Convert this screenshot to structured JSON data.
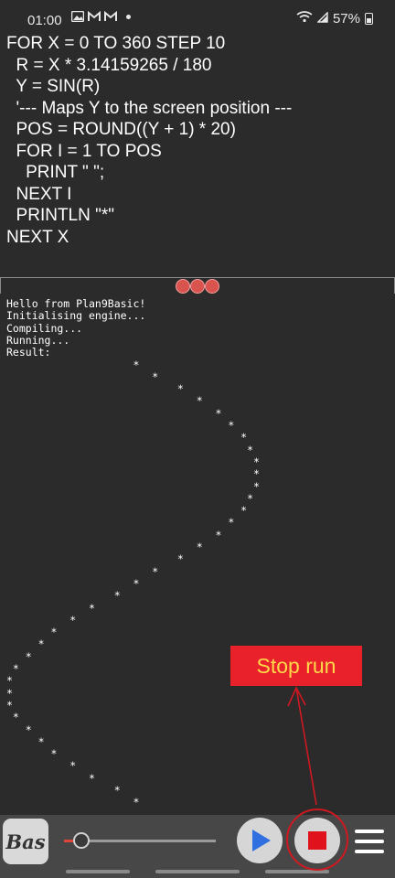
{
  "status_bar": {
    "time": "01:00",
    "battery": "57%",
    "left_icons": [
      "gallery-icon",
      "gmail-icon",
      "gmail-icon",
      "notification-dot"
    ],
    "right_icons": [
      "wifi-icon",
      "signal-icon",
      "battery-icon"
    ]
  },
  "editor": {
    "lines": [
      "FOR X = 0 TO 360 STEP 10",
      "  R = X * 3.14159265 / 180",
      "  Y = SIN(R)",
      "  '--- Maps Y to the screen position ---",
      "  POS = ROUND((Y + 1) * 20)",
      "  FOR I = 1 TO POS",
      "    PRINT \" \";",
      "  NEXT I",
      "  PRINTLN \"*\"",
      "NEXT X"
    ]
  },
  "console": {
    "lines": [
      "Hello from Plan9Basic!",
      "Initialising engine...",
      "Compiling...",
      "Running...",
      "Result:",
      "                    *",
      "                       *",
      "                           *",
      "                              *",
      "                                 *",
      "                                   *",
      "                                     *",
      "                                      *",
      "                                       *",
      "                                       *",
      "                                       *",
      "                                      *",
      "                                     *",
      "                                   *",
      "                                 *",
      "                              *",
      "                           *",
      "                       *",
      "                    *",
      "                 *",
      "             *",
      "          *",
      "       *",
      "     *",
      "   *",
      " *",
      "*",
      "*",
      "*",
      " *",
      "   *",
      "     *",
      "       *",
      "          *",
      "             *",
      "                 *",
      "                    *"
    ]
  },
  "annotation": {
    "label": "Stop run",
    "color": "#e8212a",
    "text_color": "#ffd84a"
  },
  "toolbar": {
    "bas_label": "Bas",
    "play_icon": "play-icon",
    "stop_icon": "stop-icon",
    "menu_icon": "hamburger-menu-icon",
    "accent": "#2f6fe0",
    "stop_color": "#e0121c"
  }
}
